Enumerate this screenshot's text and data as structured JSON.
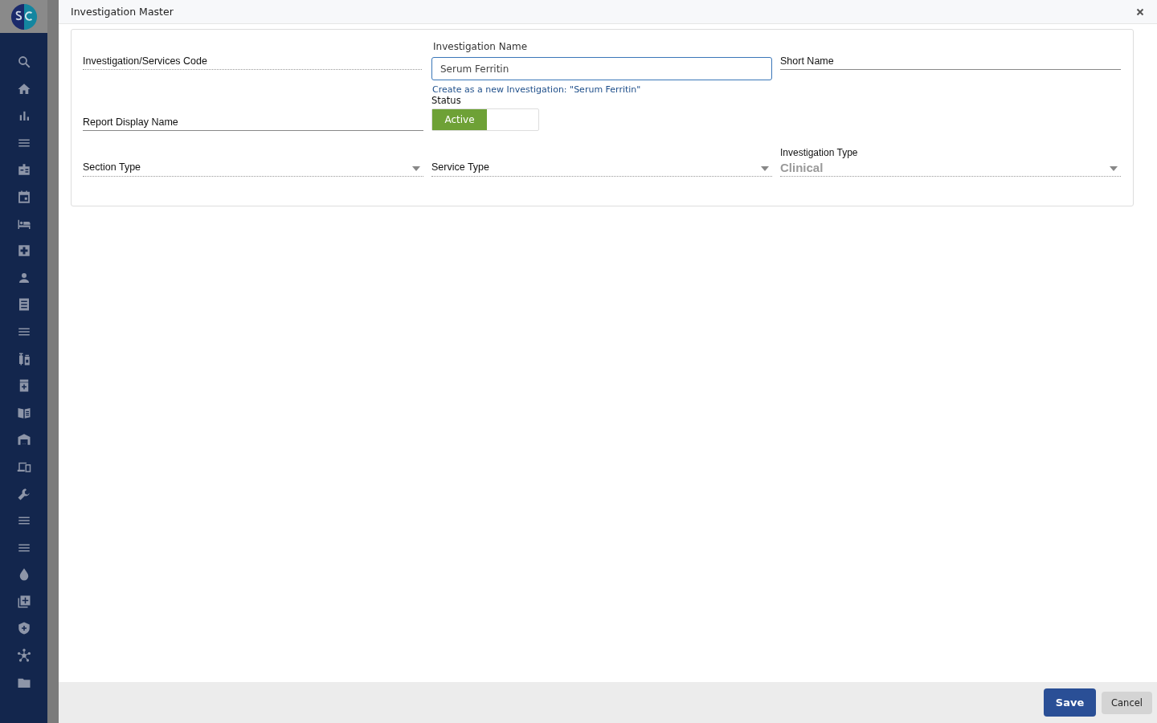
{
  "window": {
    "title": "Investigation Master"
  },
  "form": {
    "code_field": {
      "placeholder": "Investigation/Services Code"
    },
    "investigation_name": {
      "label": "Investigation Name",
      "value": "Serum Ferritin",
      "hint": "Create as a new Investigation: \"Serum Ferritin\""
    },
    "short_name": {
      "placeholder": "Short Name"
    },
    "report_display_name": {
      "placeholder": "Report Display Name"
    },
    "status": {
      "label": "Status",
      "on_label": "Active",
      "on": true
    },
    "section_type": {
      "placeholder": "Section Type"
    },
    "service_type": {
      "placeholder": "Service Type"
    },
    "investigation_type": {
      "label": "Investigation Type",
      "value": "Clinical"
    }
  },
  "footer": {
    "buttons": [
      {
        "label": "Save",
        "kind": "primary"
      },
      {
        "label": "Cancel",
        "kind": "secondary"
      }
    ]
  }
}
